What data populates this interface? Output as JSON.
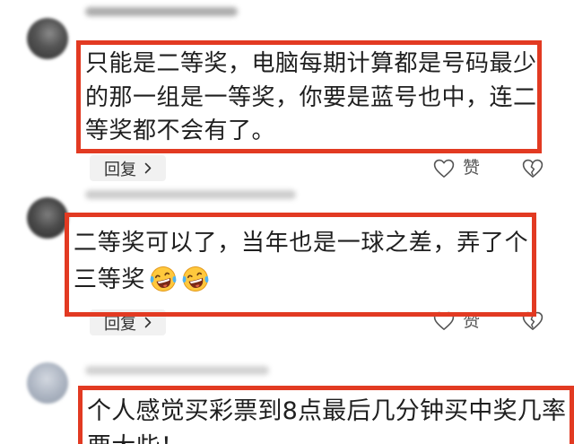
{
  "comments": [
    {
      "text_lines": [
        "只能是二等奖，电脑每期计算都是号码最少",
        "的那一组是一等奖，你要是蓝号也中，连二",
        "等奖都不会有了。"
      ],
      "reply_label": "回复",
      "like_label": "赞",
      "icons": {
        "reply": "chevron-right-icon",
        "like": "heart-outline-icon",
        "dislike": "broken-heart-icon"
      }
    },
    {
      "text_lines": [
        "二等奖可以了，当年也是一球之差，弄了个",
        "三等奖"
      ],
      "emojis": [
        "laugh-cry-icon",
        "laugh-cry-icon"
      ],
      "reply_label": "回复",
      "like_label": "赞",
      "icons": {
        "reply": "chevron-right-icon",
        "like": "heart-outline-icon",
        "dislike": "broken-heart-icon"
      }
    },
    {
      "text_lines": [
        "个人感觉买彩票到8点最后几分钟买中奖几率",
        "要大些！"
      ]
    }
  ],
  "colors": {
    "highlight_border": "#e23a22",
    "text": "#1f1f1f",
    "reply_background": "#f1f1f1",
    "icon": "#555555"
  }
}
